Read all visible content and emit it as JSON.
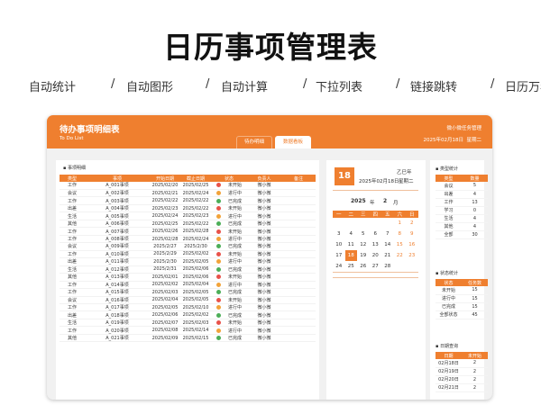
{
  "hero_title": "日历事项管理表",
  "features": [
    "自动统计",
    "/",
    "自动图形",
    "/",
    "自动计算",
    "/",
    "下拉列表",
    "/",
    "链接跳转",
    "/",
    "日历万年历"
  ],
  "banner": {
    "title": "待办事项明细表",
    "subtitle": "To Do List",
    "right_title": "微小微任务管理",
    "right_date": "2025年02月18日",
    "right_weekday": "星期二"
  },
  "tabs": [
    {
      "label": "待办明细"
    },
    {
      "label": "数据看板"
    }
  ],
  "table": {
    "title": "事项明细",
    "headers": [
      "类型",
      "事项",
      "开始日期",
      "截止日期",
      "状态",
      "负责人",
      "备注"
    ],
    "rows": [
      [
        "工作",
        "A_001事项",
        "2025/02/20",
        "2025/02/25",
        "未开始",
        "微小微"
      ],
      [
        "会议",
        "A_002事项",
        "2025/02/21",
        "2025/02/24",
        "进行中",
        "微小微"
      ],
      [
        "工作",
        "A_003事项",
        "2025/02/22",
        "2025/02/22",
        "已完成",
        "微小微"
      ],
      [
        "出差",
        "A_004事项",
        "2025/02/23",
        "2025/02/22",
        "未开始",
        "微小微"
      ],
      [
        "生活",
        "A_005事项",
        "2025/02/24",
        "2025/02/23",
        "进行中",
        "微小微"
      ],
      [
        "其他",
        "A_006事项",
        "2025/02/25",
        "2025/02/22",
        "已完成",
        "微小微"
      ],
      [
        "工作",
        "A_007事项",
        "2025/02/26",
        "2025/02/28",
        "未开始",
        "微小微"
      ],
      [
        "工作",
        "A_008事项",
        "2025/02/28",
        "2025/02/24",
        "进行中",
        "微小微"
      ],
      [
        "会议",
        "A_009事项",
        "2025/2/27",
        "2025/2/30",
        "已完成",
        "微小微"
      ],
      [
        "工作",
        "A_010事项",
        "2025/2/29",
        "2025/02/02",
        "未开始",
        "微小微"
      ],
      [
        "出差",
        "A_011事项",
        "2025/2/30",
        "2025/02/05",
        "进行中",
        "微小微"
      ],
      [
        "生活",
        "A_012事项",
        "2025/2/31",
        "2025/02/06",
        "已完成",
        "微小微"
      ],
      [
        "其他",
        "A_013事项",
        "2025/02/01",
        "2025/02/06",
        "未开始",
        "微小微"
      ],
      [
        "工作",
        "A_014事项",
        "2025/02/02",
        "2025/02/04",
        "进行中",
        "微小微"
      ],
      [
        "工作",
        "A_015事项",
        "2025/02/03",
        "2025/02/05",
        "已完成",
        "微小微"
      ],
      [
        "会议",
        "A_016事项",
        "2025/02/04",
        "2025/02/05",
        "未开始",
        "微小微"
      ],
      [
        "工作",
        "A_017事项",
        "2025/02/05",
        "2025/02/10",
        "进行中",
        "微小微"
      ],
      [
        "出差",
        "A_018事项",
        "2025/02/06",
        "2025/02/02",
        "已完成",
        "微小微"
      ],
      [
        "生活",
        "A_019事项",
        "2025/02/07",
        "2025/02/03",
        "未开始",
        "微小微"
      ],
      [
        "工作",
        "A_020事项",
        "2025/02/08",
        "2025/02/14",
        "进行中",
        "微小微"
      ],
      [
        "其他",
        "A_021事项",
        "2025/02/09",
        "2025/02/15",
        "已完成",
        "微小微"
      ]
    ]
  },
  "status_colors": {
    "未开始": "#e8524a",
    "进行中": "#f2a33a",
    "已完成": "#4cae58"
  },
  "calendar": {
    "day": "18",
    "lunar": "乙巳年",
    "date_text": "2025年02月18日",
    "weekday": "星期二",
    "year": "2025",
    "year_unit": "年",
    "month": "2",
    "month_unit": "月",
    "weekdays": [
      "一",
      "二",
      "三",
      "四",
      "五",
      "六",
      "日"
    ],
    "weeks": [
      [
        "",
        "",
        "",
        "",
        "",
        "1",
        "2"
      ],
      [
        "3",
        "4",
        "5",
        "6",
        "7",
        "8",
        "9"
      ],
      [
        "10",
        "11",
        "12",
        "13",
        "14",
        "15",
        "16"
      ],
      [
        "17",
        "18",
        "19",
        "20",
        "21",
        "22",
        "23"
      ],
      [
        "24",
        "25",
        "26",
        "27",
        "28",
        "",
        ""
      ]
    ],
    "today": "18"
  },
  "stats": {
    "type": {
      "title": "类型统计",
      "headers": [
        "类型",
        "数量"
      ],
      "rows": [
        [
          "会议",
          "5"
        ],
        [
          "出差",
          "4"
        ],
        [
          "工作",
          "13"
        ],
        [
          "学习",
          "0"
        ],
        [
          "生活",
          "4"
        ],
        [
          "其他",
          "4"
        ],
        [
          "全部",
          "30"
        ]
      ]
    },
    "status": {
      "title": "状态统计",
      "headers": [
        "状态",
        "任务数"
      ],
      "rows": [
        [
          "未开始",
          "15"
        ],
        [
          "进行中",
          "15"
        ],
        [
          "已完成",
          "15"
        ],
        [
          "全部状态",
          "45"
        ]
      ]
    },
    "date": {
      "title": "日期查询",
      "headers": [
        "日期",
        "未开始"
      ],
      "rows": [
        [
          "02月18日",
          "2"
        ],
        [
          "02月19日",
          "2"
        ],
        [
          "02月20日",
          "2"
        ],
        [
          "02月21日",
          "2"
        ]
      ]
    }
  }
}
